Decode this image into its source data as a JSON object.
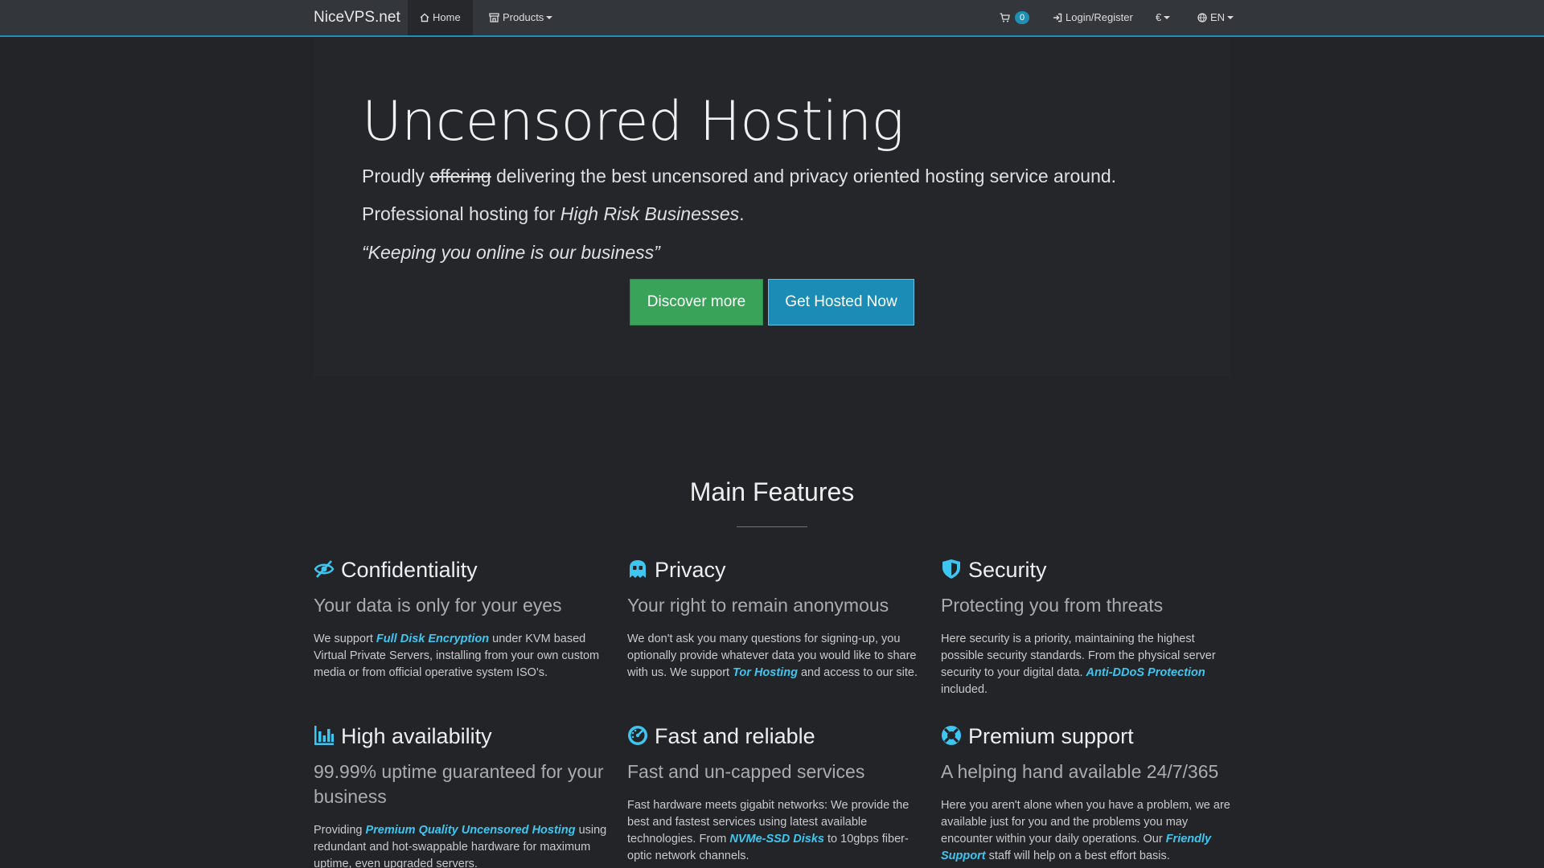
{
  "nav": {
    "brand": "NiceVPS.net",
    "home": "Home",
    "products": "Products",
    "cart_count": "0",
    "login": "Login/Register",
    "currency": "€",
    "language": "EN"
  },
  "hero": {
    "title": "Uncensored Hosting",
    "line1_a": "Proudly ",
    "line1_struck": "offering",
    "line1_b": " delivering the best uncensored and privacy oriented hosting service around.",
    "line2_a": "Professional hosting for ",
    "line2_em": "High Risk Businesses",
    "line2_b": ".",
    "quote": "Keeping you online is our business",
    "discover_button": "Discover more",
    "hosted_button": "Get Hosted Now"
  },
  "features": {
    "title": "Main Features",
    "items": [
      {
        "icon": "eye-slash-icon",
        "title": "Confidentiality",
        "subtitle": "Your data is only for your eyes",
        "text_a": "We support ",
        "highlight": "Full Disk Encryption",
        "text_b": " under KVM based Virtual Private Servers, installing from your own custom media or from official operative system ISO's."
      },
      {
        "icon": "ghost-icon",
        "title": "Privacy",
        "subtitle": "Your right to remain anonymous",
        "text_a": "We don't ask you many questions for signing-up, you optionally provide whatever data you would like to share with us. We support ",
        "highlight": "Tor Hosting",
        "text_b": " and access to our site."
      },
      {
        "icon": "shield-icon",
        "title": "Security",
        "subtitle": "Protecting you from threats",
        "text_a": "Here security is a priority, maintaining the highest possible security standards. From the physical server security to your digital data. ",
        "highlight": "Anti-DDoS Protection",
        "text_b": " included."
      },
      {
        "icon": "bar-chart-icon",
        "title": "High availability",
        "subtitle": "99.99% uptime guaranteed for your business",
        "text_a": "Providing ",
        "highlight": "Premium Quality Uncensored Hosting",
        "text_b": " using redundant and hot-swappable hardware for maximum uptime, even upgraded servers."
      },
      {
        "icon": "tachometer-icon",
        "title": "Fast and reliable",
        "subtitle": "Fast and un-capped services",
        "text_a": "Fast hardware meets gigabit networks: We provide the best and fastest services using latest available technologies. From ",
        "highlight": "NVMe-SSD Disks",
        "text_b": " to 10gbps fiber-optic network channels."
      },
      {
        "icon": "lifebuoy-icon",
        "title": "Premium support",
        "subtitle": "A helping hand available 24/7/365",
        "text_a": "Here you aren't alone when you have a problem, we are available just for you and the problems you may encounter within your daily operations. Our ",
        "highlight": "Friendly Support",
        "text_b": " staff will help on a best effort basis."
      }
    ]
  }
}
